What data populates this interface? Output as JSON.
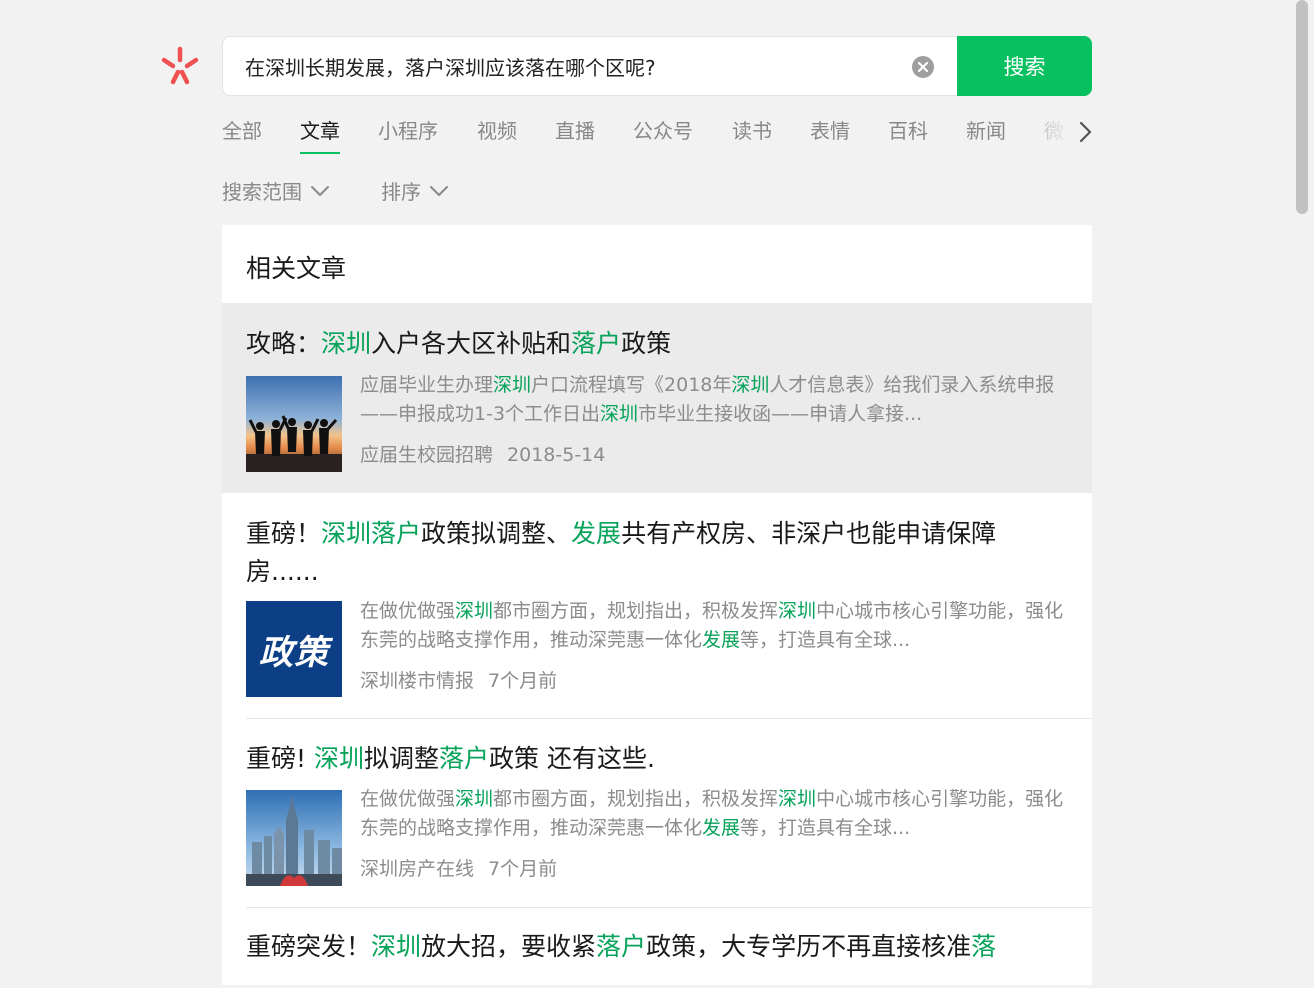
{
  "logo": {
    "icon": "wechat-search-logo-icon",
    "color": "#f05252"
  },
  "search": {
    "query": "在深圳长期发展，落户深圳应该落在哪个区呢?",
    "button_label": "搜索",
    "accent": "#07c160"
  },
  "tabs": [
    "全部",
    "文章",
    "小程序",
    "视频",
    "直播",
    "公众号",
    "读书",
    "表情",
    "百科",
    "新闻",
    "微"
  ],
  "active_tab": "文章",
  "filters": {
    "range_label": "搜索范围",
    "sort_label": "排序"
  },
  "section_title": "相关文章",
  "articles": [
    {
      "title": [
        {
          "t": "攻略："
        },
        {
          "t": "深圳",
          "hl": true
        },
        {
          "t": "入户各大区补贴和"
        },
        {
          "t": "落户",
          "hl": true
        },
        {
          "t": "政策"
        }
      ],
      "desc": [
        {
          "t": "应届毕业生办理"
        },
        {
          "t": "深圳",
          "hl": true
        },
        {
          "t": "户口流程填写《2018年"
        },
        {
          "t": "深圳",
          "hl": true
        },
        {
          "t": "人才信息表》给我们录入系统申报——申报成功1-3个工作日出"
        },
        {
          "t": "深圳",
          "hl": true
        },
        {
          "t": "市毕业生接收函——申请人拿接..."
        }
      ],
      "source": "应届生校园招聘",
      "date": "2018-5-14",
      "thumb_icon": "graduates-silhouette-thumbnail"
    },
    {
      "title": [
        {
          "t": "重磅！"
        },
        {
          "t": "深圳落户",
          "hl": true
        },
        {
          "t": "政策拟调整、"
        },
        {
          "t": "发展",
          "hl": true
        },
        {
          "t": "共有产权房、非深户也能申请保障房......"
        }
      ],
      "desc": [
        {
          "t": "在做优做强"
        },
        {
          "t": "深圳",
          "hl": true
        },
        {
          "t": "都市圈方面，规划指出，积极发挥"
        },
        {
          "t": "深圳",
          "hl": true
        },
        {
          "t": "中心城市核心引擎功能，强化东莞的战略支撑作用，推动深莞惠一体化"
        },
        {
          "t": "发展",
          "hl": true
        },
        {
          "t": "等，打造具有全球..."
        }
      ],
      "source": "深圳楼市情报",
      "date": "7个月前",
      "thumb_icon": "policy-thumbnail",
      "thumb_text": "政策"
    },
    {
      "title": [
        {
          "t": "重磅! "
        },
        {
          "t": "深圳",
          "hl": true
        },
        {
          "t": "拟调整"
        },
        {
          "t": "落户",
          "hl": true
        },
        {
          "t": "政策 还有这些."
        }
      ],
      "desc": [
        {
          "t": "在做优做强"
        },
        {
          "t": "深圳",
          "hl": true
        },
        {
          "t": "都市圈方面，规划指出，积极发挥"
        },
        {
          "t": "深圳",
          "hl": true
        },
        {
          "t": "中心城市核心引擎功能，强化东莞的战略支撑作用，推动深莞惠一体化"
        },
        {
          "t": "发展",
          "hl": true
        },
        {
          "t": "等，打造具有全球..."
        }
      ],
      "source": "深圳房产在线",
      "date": "7个月前",
      "thumb_icon": "city-skyline-thumbnail"
    },
    {
      "title": [
        {
          "t": "重磅突发！"
        },
        {
          "t": "深圳",
          "hl": true
        },
        {
          "t": "放大招，要收紧"
        },
        {
          "t": "落户",
          "hl": true
        },
        {
          "t": "政策，大专学历不再直接核准"
        },
        {
          "t": "落",
          "hl": true
        }
      ]
    }
  ]
}
